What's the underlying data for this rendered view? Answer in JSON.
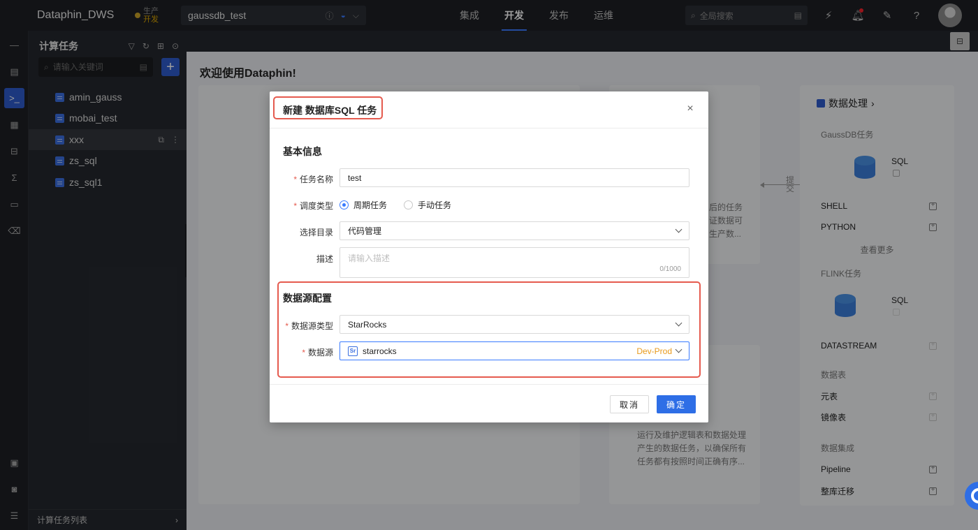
{
  "topbar": {
    "brand": "Dataphin_DWS",
    "env_prod": "生产",
    "env_dev": "开发",
    "project": "gaussdb_test",
    "nav": [
      "集成",
      "开发",
      "发布",
      "运维"
    ],
    "nav_active_index": 1,
    "search_placeholder": "全局搜索"
  },
  "tree": {
    "title": "计算任务",
    "search_placeholder": "请输入关键词",
    "add_label": "+",
    "items": [
      "amin_gauss",
      "mobai_test",
      "xxx",
      "zs_sql",
      "zs_sql1"
    ],
    "selected_index": 2,
    "footer": "计算任务列表"
  },
  "main": {
    "welcome": "欢迎使用Dataphin!",
    "card_mid_text": [
      "后的任务",
      "证数据可",
      "生产数..."
    ],
    "arrow_label": "提交",
    "card_bottom_text": [
      "运行及维护逻辑表和数据处理",
      "产生的数据任务，以确保所有",
      "任务都有按照时间正确有序..."
    ]
  },
  "catalog": {
    "title": "数据处理",
    "gaussdb_group": "GaussDB任务",
    "sql_label": "SQL",
    "shell": "SHELL",
    "python": "PYTHON",
    "more": "查看更多",
    "flink_group": "FLINK任务",
    "flink_sql": "SQL",
    "datastream": "DATASTREAM",
    "table_group": "数据表",
    "meta_table": "元表",
    "mirror_table": "镜像表",
    "integration_group": "数据集成",
    "pipeline": "Pipeline",
    "migration": "整库迁移"
  },
  "modal": {
    "title": "新建 数据库SQL 任务",
    "close": "×",
    "basic_section": "基本信息",
    "task_name_label": "任务名称",
    "task_name_value": "test",
    "schedule_label": "调度类型",
    "schedule_options": [
      "周期任务",
      "手动任务"
    ],
    "schedule_selected": "周期任务",
    "dir_label": "选择目录",
    "dir_value": "代码管理",
    "desc_label": "描述",
    "desc_placeholder": "请输入描述",
    "desc_count": "0/1000",
    "ds_section": "数据源配置",
    "ds_type_label": "数据源类型",
    "ds_type_value": "StarRocks",
    "ds_label": "数据源",
    "ds_icon_text": "Sr",
    "ds_value": "starrocks",
    "ds_env": "Dev-Prod",
    "cancel": "取消",
    "ok": "确定"
  },
  "colors": {
    "accent": "#2e6ee6",
    "highlight": "#e55a4e",
    "env_tag": "#e89a1c"
  }
}
